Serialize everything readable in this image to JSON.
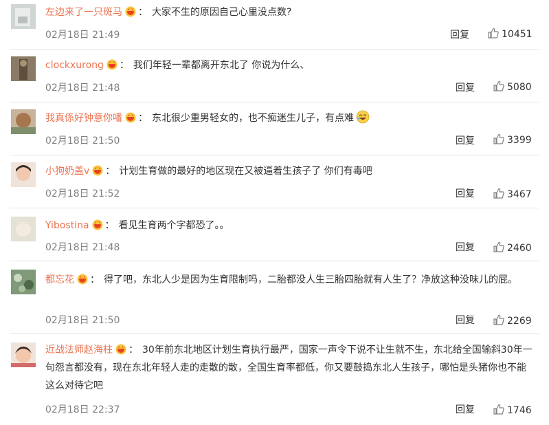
{
  "comments": [
    {
      "user": "左边来了一只斑马",
      "text": "大家不生的原因自己心里没点数?",
      "time": "02月18日 21:49",
      "reply": "回复",
      "likes": "10451",
      "avatar_color": "#cfd6d3"
    },
    {
      "user": "clockxurong",
      "text": "我们年轻一辈都离开东北了 你说为什么、",
      "time": "02月18日 21:48",
      "reply": "回复",
      "likes": "5080",
      "avatar_color": "#7a6a58"
    },
    {
      "user": "我真係好钟意你噃",
      "text": "东北很少重男轻女的，也不痴迷生儿子，有点难",
      "time": "02月18日 21:50",
      "reply": "回复",
      "likes": "3399",
      "avatar_color": "#b89a7a"
    },
    {
      "user": "小狗奶盖v",
      "text": "计划生育做的最好的地区现在又被逼着生孩子了 你们有毒吧",
      "time": "02月18日 21:52",
      "reply": "回复",
      "likes": "3467",
      "avatar_color": "#e8d4c6"
    },
    {
      "user": "Yibostina",
      "text": "看见生育两个字都恐了。。",
      "time": "02月18日 21:48",
      "reply": "回复",
      "likes": "2460",
      "avatar_color": "#d8d5c2"
    },
    {
      "user": "都忘花",
      "text": "得了吧，东北人少是因为生育限制吗，二胎都没人生三胎四胎就有人生了？净放这种没味儿的屁。",
      "time": "02月18日 21:50",
      "reply": "回复",
      "likes": "2269",
      "avatar_color": "#6f8a6a"
    },
    {
      "user": "近战法师赵海柱",
      "text": "30年前东北地区计划生育执行最严，国家一声令下说不让生就不生，东北给全国输斜30年一句怨言都没有，现在东北年轻人走的走散的散，全国生育率都低，你又要鼓捣东北人生孩子，哪怕是头猪你也不能这么对待它吧",
      "time": "02月18日 22:37",
      "reply": "回复",
      "likes": "1746",
      "avatar_color": "#d9b7a2"
    }
  ],
  "colors": {
    "username": "#eb7350",
    "meta": "#808080",
    "divider": "#e6e6e6"
  }
}
